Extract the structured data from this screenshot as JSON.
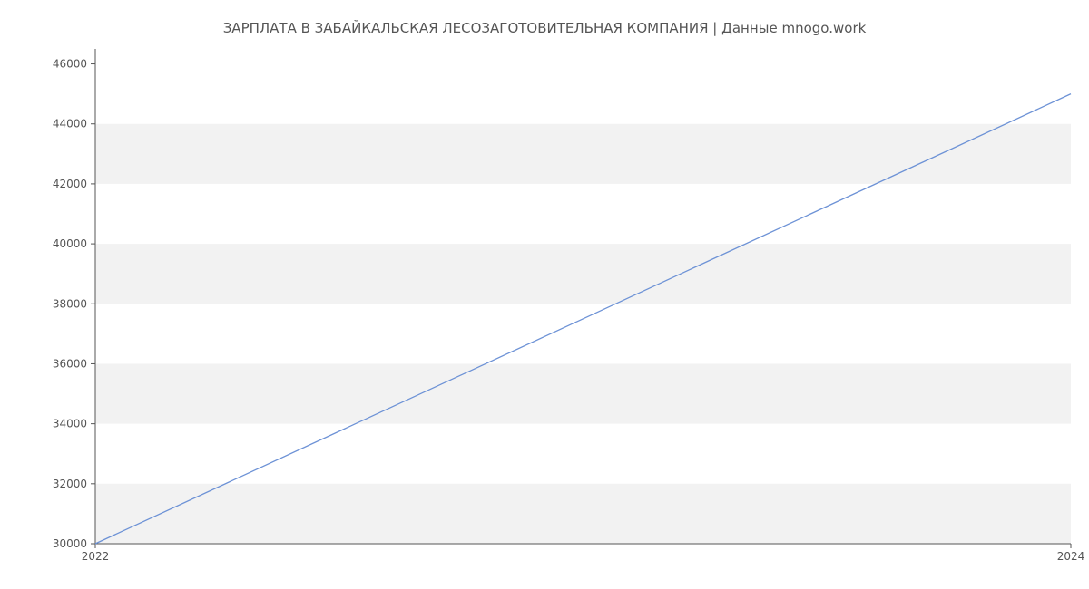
{
  "chart_data": {
    "type": "line",
    "title": "ЗАРПЛАТА В  ЗАБАЙКАЛЬСКАЯ ЛЕСОЗАГОТОВИТЕЛЬНАЯ КОМПАНИЯ | Данные mnogo.work",
    "x": [
      2022,
      2024
    ],
    "values": [
      30000,
      45000
    ],
    "xticks": [
      2022,
      2024
    ],
    "yticks": [
      30000,
      32000,
      34000,
      36000,
      38000,
      40000,
      42000,
      44000,
      46000
    ],
    "xlim": [
      2022,
      2024
    ],
    "ylim": [
      30000,
      46500
    ],
    "xlabel": "",
    "ylabel": ""
  }
}
